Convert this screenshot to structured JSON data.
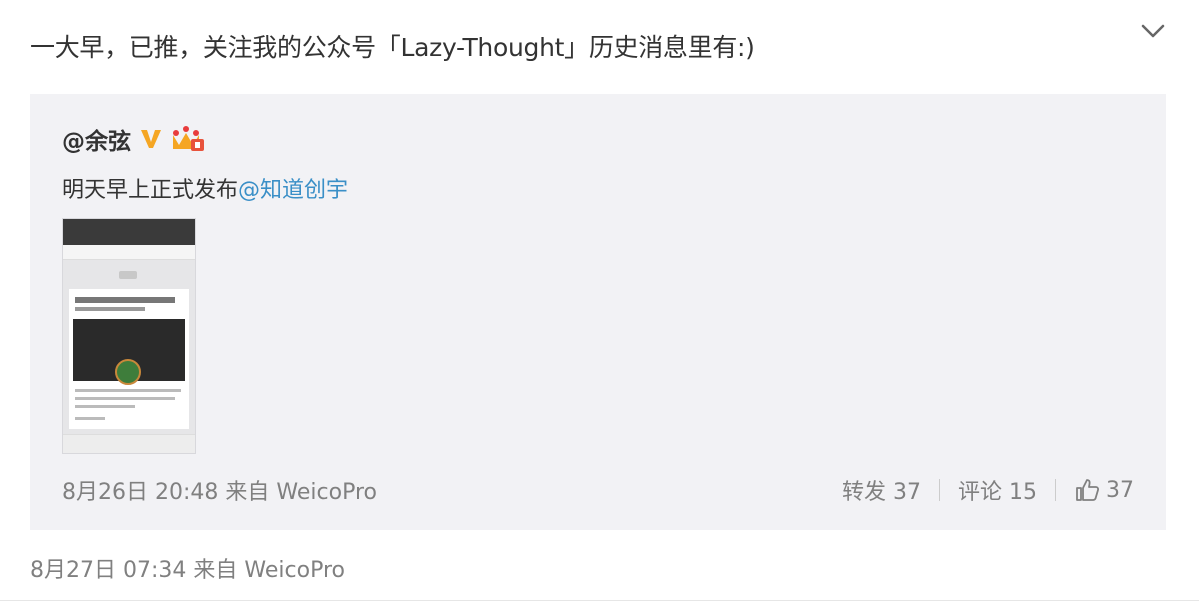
{
  "post": {
    "text": "一大早，已推，关注我的公众号「Lazy-Thought」历史消息里有:)",
    "footer_time": "8月27日 07:34",
    "footer_source_prefix": "来自",
    "footer_source": "WeicoPro"
  },
  "repost": {
    "author": "@余弦",
    "text_prefix": "明天早上正式发布",
    "mention": "@知道创宇",
    "time": "8月26日 20:48",
    "source_prefix": "来自",
    "source": "WeicoPro",
    "repost_label": "转发",
    "repost_count": "37",
    "comment_label": "评论",
    "comment_count": "15",
    "like_count": "37"
  },
  "icons": {
    "expand": "chevron-down-icon",
    "verified": "verified-v-icon",
    "badge": "crown-badge-icon",
    "like": "thumbs-up-icon"
  },
  "colors": {
    "mention": "#3a8fc7",
    "verified": "#f5a623",
    "repost_bg": "#f2f2f5",
    "meta_text": "#808080"
  }
}
